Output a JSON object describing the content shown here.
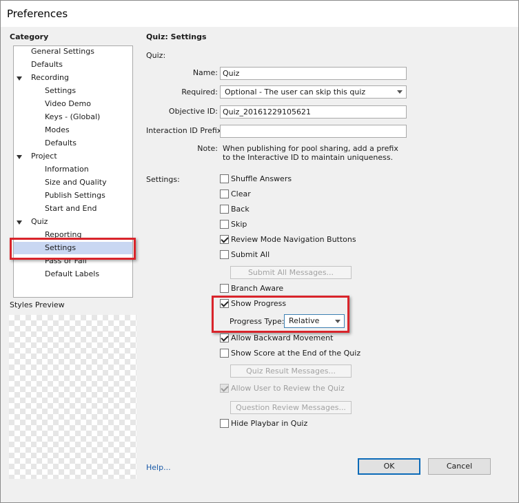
{
  "window": {
    "title": "Preferences"
  },
  "category": {
    "header": "Category",
    "items": [
      {
        "label": "General Settings"
      },
      {
        "label": "Defaults"
      },
      {
        "label": "Recording"
      },
      {
        "label": "Settings"
      },
      {
        "label": "Video Demo"
      },
      {
        "label": "Keys - (Global)"
      },
      {
        "label": "Modes"
      },
      {
        "label": "Defaults"
      },
      {
        "label": "Project"
      },
      {
        "label": "Information"
      },
      {
        "label": "Size and Quality"
      },
      {
        "label": "Publish Settings"
      },
      {
        "label": "Start and End"
      },
      {
        "label": "Quiz"
      },
      {
        "label": "Reporting"
      },
      {
        "label": "Settings"
      },
      {
        "label": "Pass or Fail"
      },
      {
        "label": "Default Labels"
      }
    ],
    "selected": "Settings"
  },
  "styles_preview": {
    "label": "Styles Preview"
  },
  "panel": {
    "title": "Quiz: Settings",
    "quiz_section": "Quiz:",
    "name_label": "Name:",
    "name_value": "Quiz",
    "required_label": "Required:",
    "required_value": "Optional - The user can skip this quiz",
    "objective_label": "Objective ID:",
    "objective_value": "Quiz_20161229105621",
    "interaction_label": "Interaction ID Prefix:",
    "interaction_value": "",
    "note_label": "Note:",
    "note_line1": "When publishing for pool sharing, add a prefix",
    "note_line2": "to the Interactive ID to maintain uniqueness.",
    "settings_label": "Settings:"
  },
  "options": {
    "shuffle_answers": {
      "label": "Shuffle Answers",
      "checked": false
    },
    "clear": {
      "label": "Clear",
      "checked": false
    },
    "back": {
      "label": "Back",
      "checked": false
    },
    "skip": {
      "label": "Skip",
      "checked": false
    },
    "review_nav": {
      "label": "Review Mode Navigation Buttons",
      "checked": true
    },
    "submit_all": {
      "label": "Submit All",
      "checked": false
    },
    "submit_all_messages": "Submit All Messages...",
    "branch_aware": {
      "label": "Branch Aware",
      "checked": false
    },
    "show_progress": {
      "label": "Show Progress",
      "checked": true
    },
    "progress_type_label": "Progress Type:",
    "progress_type_value": "Relative",
    "allow_backward": {
      "label": "Allow Backward Movement",
      "checked": true
    },
    "show_score": {
      "label": "Show Score at the End of the Quiz",
      "checked": false
    },
    "quiz_result_messages": "Quiz Result Messages...",
    "allow_review": {
      "label": "Allow User to Review the Quiz",
      "checked": true,
      "disabled": true
    },
    "question_review_messages": "Question Review Messages...",
    "hide_playbar": {
      "label": "Hide Playbar in Quiz",
      "checked": false
    }
  },
  "footer": {
    "help": "Help...",
    "ok": "OK",
    "cancel": "Cancel"
  },
  "colors": {
    "highlight": "#d9242b",
    "selection": "#c9d7f2",
    "link": "#1a5aa8"
  }
}
